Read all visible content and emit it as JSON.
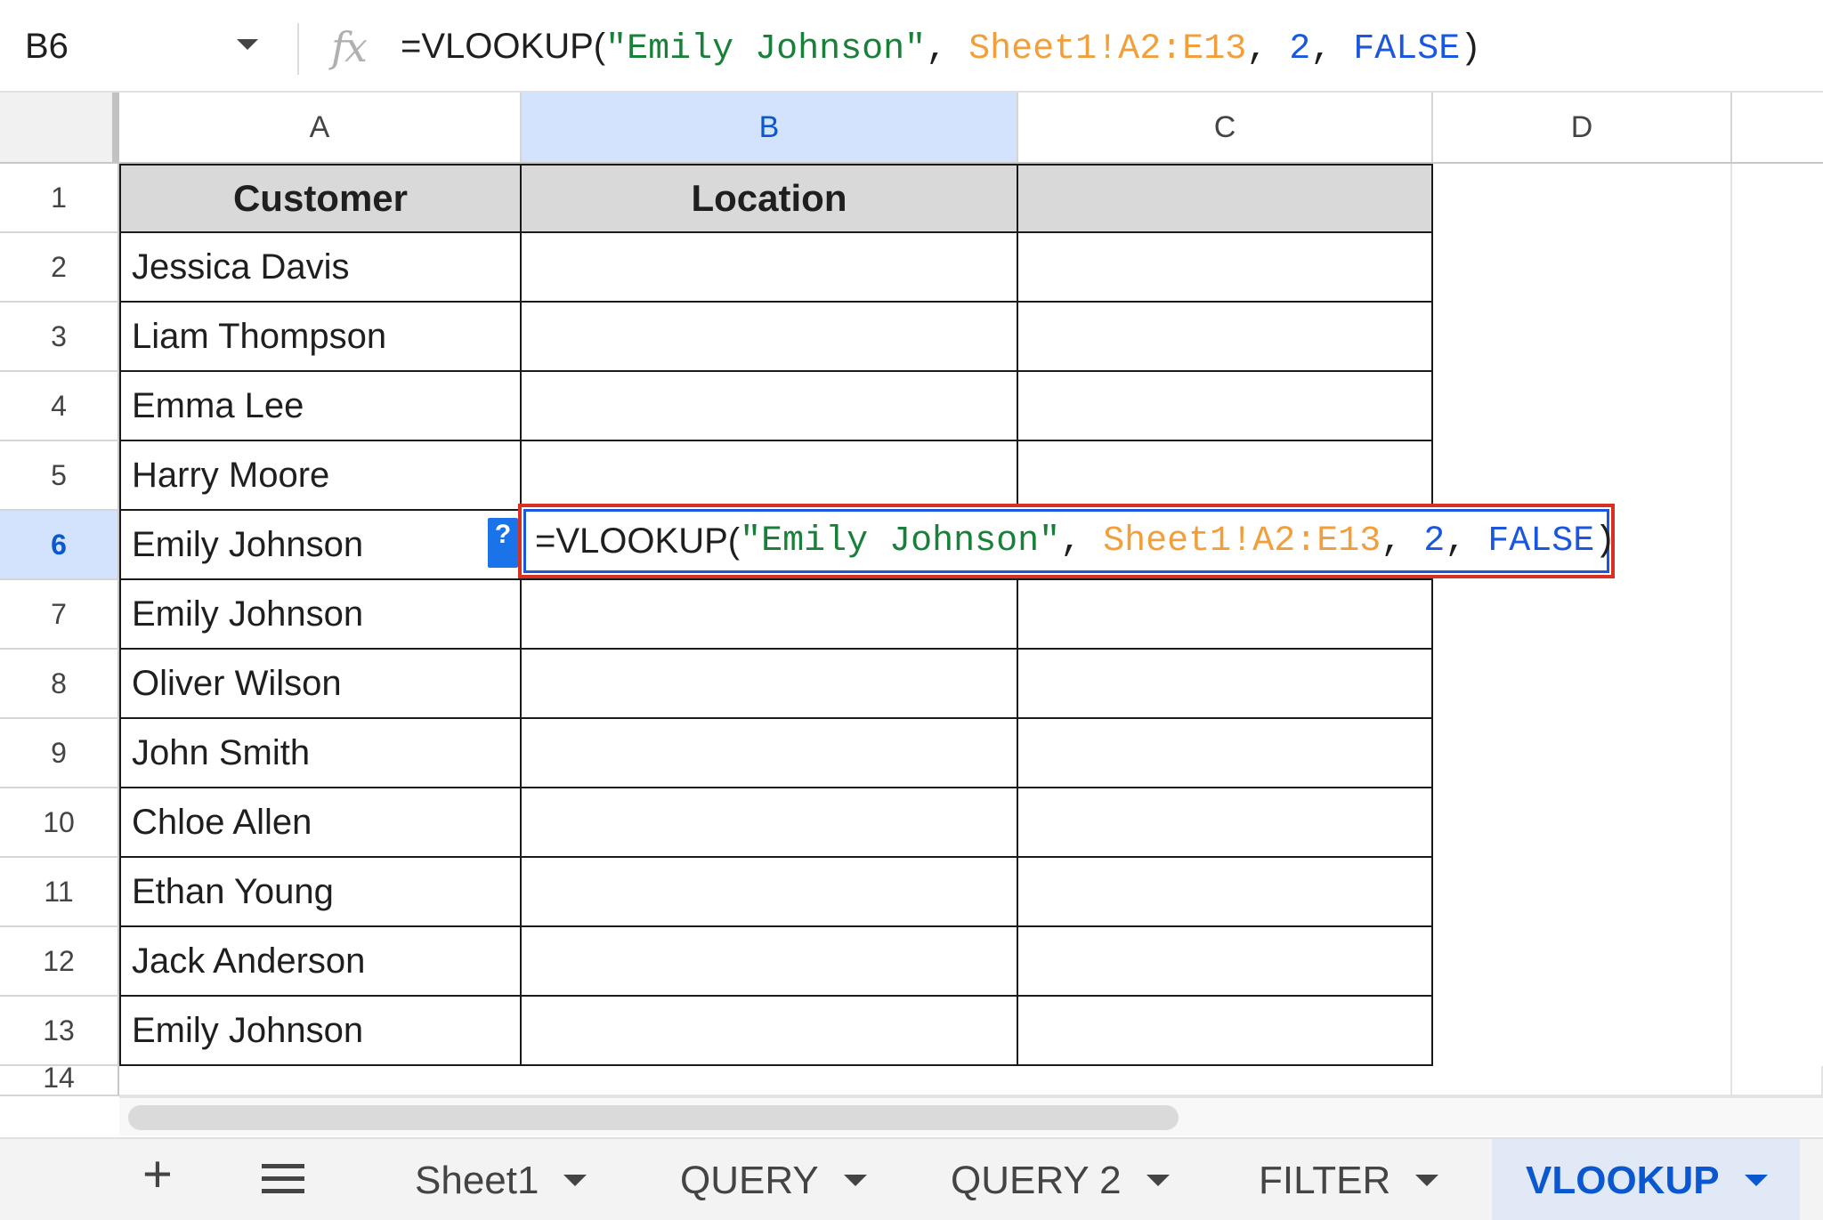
{
  "formula_bar": {
    "cell_ref": "B6",
    "fx_label": "fx",
    "formula": {
      "fn": "=VLOOKUP(",
      "arg1": "\"Emily Johnson\"",
      "sep1": ", ",
      "arg2": "Sheet1!A2:E13",
      "sep2": ", ",
      "arg3": "2",
      "sep3": ", ",
      "arg4": "FALSE",
      "close": ")"
    }
  },
  "columns": [
    "A",
    "B",
    "C",
    "D"
  ],
  "rows": [
    "1",
    "2",
    "3",
    "4",
    "5",
    "6",
    "7",
    "8",
    "9",
    "10",
    "11",
    "12",
    "13",
    "14"
  ],
  "table": {
    "headers": [
      "Customer",
      "Location",
      ""
    ],
    "customers": [
      "Jessica Davis",
      "Liam Thompson",
      "Emma Lee",
      "Harry Moore",
      "Emily Johnson",
      "Emily Johnson",
      "Oliver Wilson",
      "John Smith",
      "Chloe Allen",
      "Ethan Young",
      "Jack Anderson",
      "Emily Johnson"
    ]
  },
  "editor": {
    "help_label": "?"
  },
  "sheet_tabs": {
    "add_label": "+",
    "tabs": [
      "Sheet1",
      "QUERY",
      "QUERY 2",
      "FILTER",
      "VLOOKUP"
    ],
    "active": "VLOOKUP"
  },
  "colors": {
    "string": "#188038",
    "range": "#f29f3b",
    "number": "#1a56e0",
    "selection": "#d3e3fd",
    "edit_border": "#d93025"
  }
}
